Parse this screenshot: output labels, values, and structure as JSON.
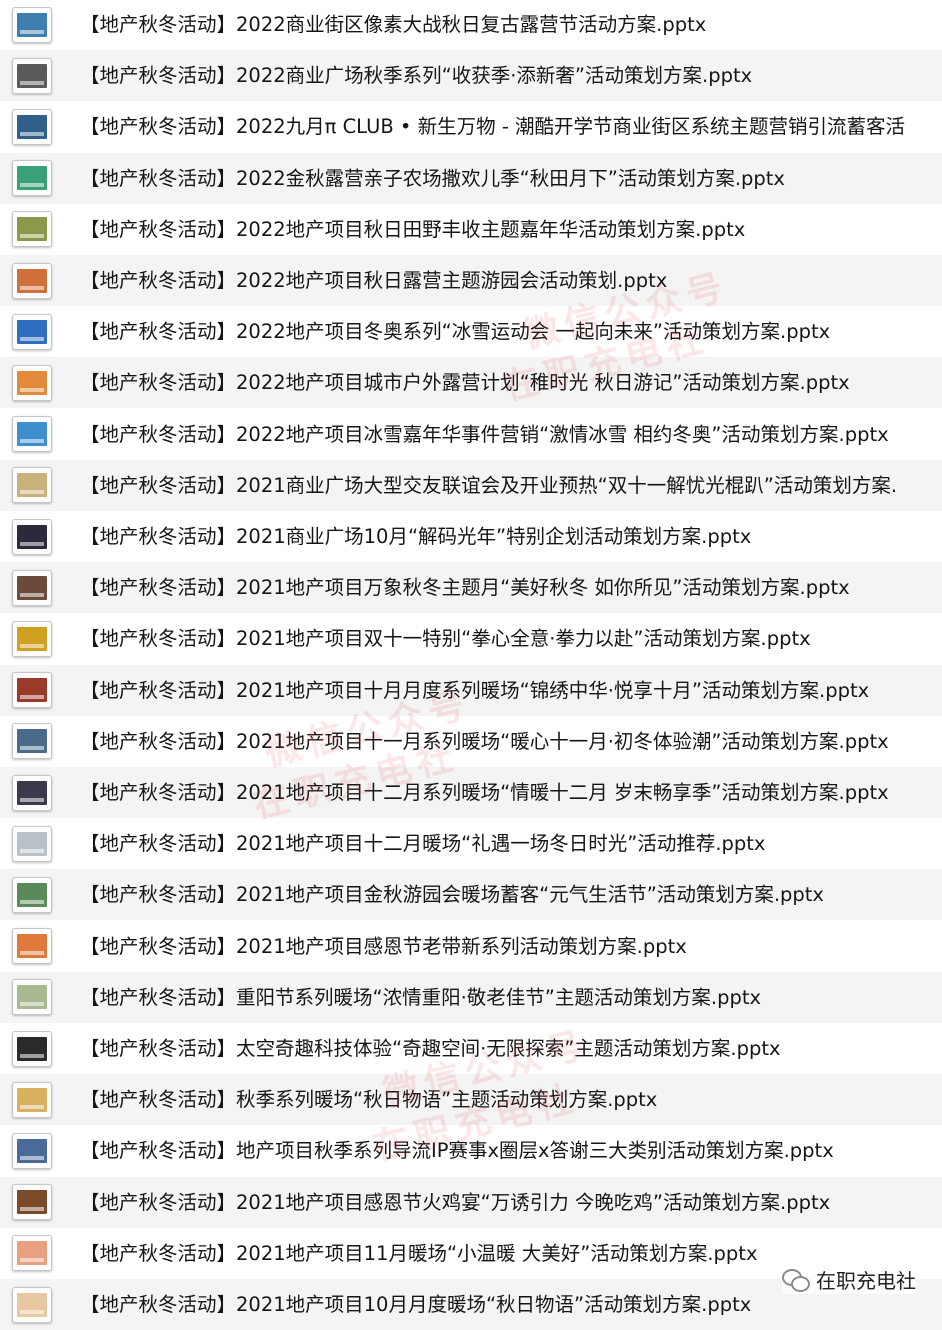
{
  "files": [
    {
      "name": "【地产秋冬活动】2022商业街区像素大战秋日复古露营节活动方案.pptx",
      "thumb_color": "#3f7fb0"
    },
    {
      "name": "【地产秋冬活动】2022商业广场秋季系列“收获季·添新奢”活动策划方案.pptx",
      "thumb_color": "#5a5a5a"
    },
    {
      "name": "【地产秋冬活动】2022九月π CLUB • 新生万物 - 潮酷开学节商业街区系统主题营销引流蓄客活",
      "thumb_color": "#2f5f8a"
    },
    {
      "name": "【地产秋冬活动】2022金秋露营亲子农场撒欢儿季“秋田月下”活动策划方案.pptx",
      "thumb_color": "#3aa07a"
    },
    {
      "name": "【地产秋冬活动】2022地产项目秋日田野丰收主题嘉年华活动策划方案.pptx",
      "thumb_color": "#8a9a4a"
    },
    {
      "name": "【地产秋冬活动】2022地产项目秋日露营主题游园会活动策划.pptx",
      "thumb_color": "#d0703a"
    },
    {
      "name": "【地产秋冬活动】2022地产项目冬奥系列“冰雪运动会 一起向未来”活动策划方案.pptx",
      "thumb_color": "#2f6fc0"
    },
    {
      "name": "【地产秋冬活动】2022地产项目城市户外露营计划“稚时光 秋日游记”活动策划方案.pptx",
      "thumb_color": "#e08a3a"
    },
    {
      "name": "【地产秋冬活动】2022地产项目冰雪嘉年华事件营销“激情冰雪  相约冬奥”活动策划方案.pptx",
      "thumb_color": "#3f8fd0"
    },
    {
      "name": "【地产秋冬活动】2021商业广场大型交友联谊会及开业预热“双十一解忧光棍趴”活动策划方案.",
      "thumb_color": "#c9b27a"
    },
    {
      "name": "【地产秋冬活动】2021商业广场10月“解码光年”特别企划活动策划方案.pptx",
      "thumb_color": "#2a2a3a"
    },
    {
      "name": "【地产秋冬活动】2021地产项目万象秋冬主题月“美好秋冬 如你所见”活动策划方案.pptx",
      "thumb_color": "#6a4a3a"
    },
    {
      "name": "【地产秋冬活动】2021地产项目双十一特别“拳心全意·拳力以赴”活动策划方案.pptx",
      "thumb_color": "#d0a020"
    },
    {
      "name": "【地产秋冬活动】2021地产项目十月月度系列暖场“锦绣中华·悦享十月”活动策划方案.pptx",
      "thumb_color": "#9a3a2a"
    },
    {
      "name": "【地产秋冬活动】2021地产项目十一月系列暖场“暖心十一月·初冬体验潮”活动策划方案.pptx",
      "thumb_color": "#4a6a8a"
    },
    {
      "name": "【地产秋冬活动】2021地产项目十二月系列暖场“情暖十二月 岁末畅享季”活动策划方案.pptx",
      "thumb_color": "#3a3a4a"
    },
    {
      "name": "【地产秋冬活动】2021地产项目十二月暖场“礼遇一场冬日时光”活动推荐.pptx",
      "thumb_color": "#b8c0c8"
    },
    {
      "name": "【地产秋冬活动】2021地产项目金秋游园会暖场蓄客“元气生活节”活动策划方案.pptx",
      "thumb_color": "#5a8a5a"
    },
    {
      "name": "【地产秋冬活动】2021地产项目感恩节老带新系列活动策划方案.pptx",
      "thumb_color": "#e07a3a"
    },
    {
      "name": "【地产秋冬活动】重阳节系列暖场“浓情重阳·敬老佳节”主题活动策划方案.pptx",
      "thumb_color": "#a8b890"
    },
    {
      "name": "【地产秋冬活动】太空奇趣科技体验“奇趣空间·无限探索”主题活动策划方案.pptx",
      "thumb_color": "#2a2a2a"
    },
    {
      "name": "【地产秋冬活动】秋季系列暖场“秋日物语”主题活动策划方案.pptx",
      "thumb_color": "#d8b060"
    },
    {
      "name": "【地产秋冬活动】地产项目秋季系列导流IP赛事x圈层x答谢三大类别活动策划方案.pptx",
      "thumb_color": "#4a6a9a"
    },
    {
      "name": "【地产秋冬活动】2021地产项目感恩节火鸡宴“万诱引力 今晚吃鸡”活动策划方案.pptx",
      "thumb_color": "#7a4a2a"
    },
    {
      "name": "【地产秋冬活动】2021地产项目11月暖场“小温暖 大美好”活动策划方案.pptx",
      "thumb_color": "#e8a080"
    },
    {
      "name": "【地产秋冬活动】2021地产项目10月月度暖场“秋日物语”活动策划方案.pptx",
      "thumb_color": "#e8c8a0"
    }
  ],
  "watermark": {
    "line1": "微信公众号",
    "line2": "在职充电社"
  },
  "brand": {
    "icon": "wechat-icon",
    "text": "在职充电社"
  }
}
